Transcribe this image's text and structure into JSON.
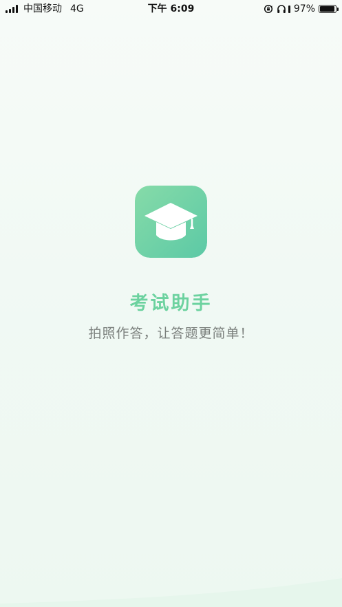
{
  "status_bar": {
    "carrier": "中国移动",
    "network": "4G",
    "time": "下午 6:09",
    "battery": "97%",
    "battery_level": 0.97,
    "icons": [
      "signal-icon",
      "rotation-lock-icon",
      "headphones-icon",
      "battery-icon"
    ]
  },
  "splash": {
    "app_icon": "graduation-cap-icon",
    "title": "考试助手",
    "subtitle": "拍照作答，让答题更简单！"
  },
  "colors": {
    "accent": "#6cd29f",
    "icon_gradient_start": "#86dba8",
    "icon_gradient_end": "#5cc9a6",
    "title": "#6cd29f",
    "subtitle": "#7a7f7c",
    "background": "#f3faf6"
  }
}
